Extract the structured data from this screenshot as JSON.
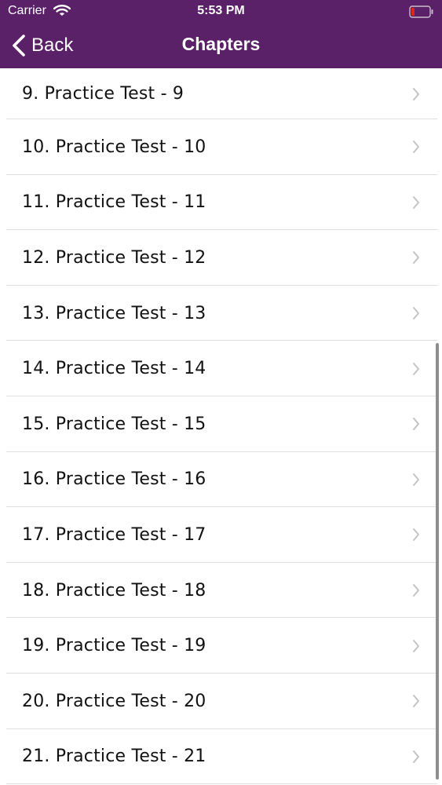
{
  "status": {
    "carrier": "Carrier",
    "time": "5:53 PM"
  },
  "nav": {
    "back_label": "Back",
    "title": "Chapters"
  },
  "chapters": [
    "9. Practice Test - 9",
    "10. Practice Test - 10",
    "11. Practice Test - 11",
    "12. Practice Test - 12",
    "13. Practice Test - 13",
    "14. Practice Test - 14",
    "15. Practice Test - 15",
    "16. Practice Test - 16",
    "17. Practice Test - 17",
    "18. Practice Test - 18",
    "19. Practice Test - 19",
    "20. Practice Test - 20",
    "21. Practice Test - 21"
  ],
  "colors": {
    "header": "#5a2068",
    "battery_low": "#e0241b"
  },
  "icons": {
    "wifi": "wifi-icon",
    "battery": "battery-icon",
    "back": "chevron-left-icon",
    "row": "chevron-right-icon"
  }
}
